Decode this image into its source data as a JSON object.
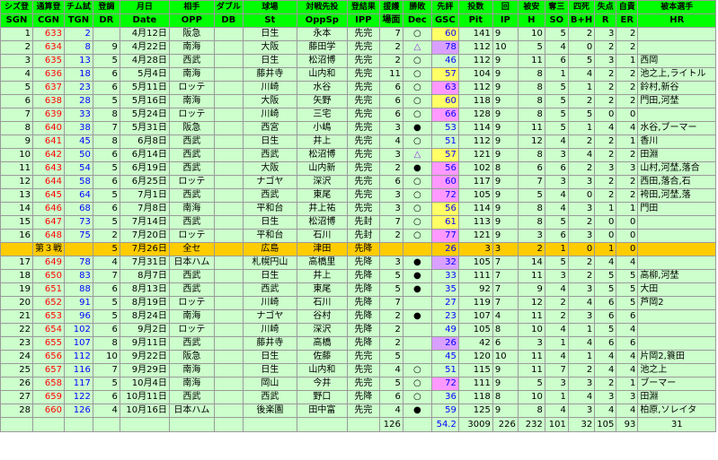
{
  "headers_top": [
    "シズ登",
    "通算登",
    "チム試",
    "登調",
    "月日",
    "相手",
    "ダブル",
    "球場",
    "対戦先投",
    "登結果",
    "援護",
    "勝敗",
    "先評",
    "投数",
    "回",
    "被安",
    "奪三",
    "四死",
    "失点",
    "自責",
    "被本選手"
  ],
  "headers_bottom": [
    "SGN",
    "CGN",
    "TGN",
    "DR",
    "Date",
    "OPP",
    "DB",
    "St",
    "OppSp",
    "IPP",
    "場面",
    "Dec",
    "GSC",
    "Pit",
    "IP",
    "H",
    "SO",
    "B+H",
    "R",
    "ER",
    "HR"
  ],
  "rows": [
    {
      "sgn": "1",
      "cgn": "633",
      "tgn": "2",
      "dr": "",
      "date": "4月12日",
      "opp": "阪急",
      "db": "",
      "st": "日生",
      "oppsp": "永本",
      "ipp": "先完",
      "sc": "7",
      "dec": "○",
      "gsc": "60",
      "gsc_class": "gsc-hi",
      "pit": "141",
      "ip": "9",
      "h": "10",
      "so": "5",
      "bh": "2",
      "r": "3",
      "er": "2",
      "hr": ""
    },
    {
      "sgn": "2",
      "cgn": "634",
      "tgn": "8",
      "dr": "9",
      "date": "4月22日",
      "opp": "南海",
      "db": "",
      "st": "大阪",
      "oppsp": "藤田学",
      "ipp": "先完",
      "sc": "2",
      "dec": "△",
      "gsc": "78",
      "gsc_class": "gsc-low",
      "pit": "112",
      "ip": "10",
      "h": "5",
      "so": "4",
      "bh": "0",
      "r": "2",
      "er": "2",
      "hr": ""
    },
    {
      "sgn": "3",
      "cgn": "635",
      "tgn": "13",
      "dr": "5",
      "date": "4月28日",
      "opp": "西武",
      "db": "",
      "st": "日生",
      "oppsp": "松沼博",
      "ipp": "先完",
      "sc": "2",
      "dec": "○",
      "gsc": "46",
      "gsc_class": "",
      "pit": "112",
      "ip": "9",
      "h": "11",
      "so": "6",
      "bh": "5",
      "r": "3",
      "er": "1",
      "hr": "西岡"
    },
    {
      "sgn": "4",
      "cgn": "636",
      "tgn": "18",
      "dr": "6",
      "date": "5月4日",
      "opp": "南海",
      "db": "",
      "st": "藤井寺",
      "oppsp": "山内和",
      "ipp": "先完",
      "sc": "11",
      "dec": "○",
      "gsc": "57",
      "gsc_class": "gsc-hi",
      "pit": "104",
      "ip": "9",
      "h": "8",
      "so": "1",
      "bh": "4",
      "r": "2",
      "er": "2",
      "hr": "池之上,ライトル"
    },
    {
      "sgn": "5",
      "cgn": "637",
      "tgn": "23",
      "dr": "6",
      "date": "5月11日",
      "opp": "ロッテ",
      "db": "",
      "st": "川崎",
      "oppsp": "水谷",
      "ipp": "先完",
      "sc": "6",
      "dec": "○",
      "gsc": "63",
      "gsc_class": "gsc-mid",
      "pit": "112",
      "ip": "9",
      "h": "8",
      "so": "5",
      "bh": "1",
      "r": "2",
      "er": "2",
      "hr": "鈴村,新谷"
    },
    {
      "sgn": "6",
      "cgn": "638",
      "tgn": "28",
      "dr": "5",
      "date": "5月16日",
      "opp": "南海",
      "db": "",
      "st": "大阪",
      "oppsp": "矢野",
      "ipp": "先完",
      "sc": "6",
      "dec": "○",
      "gsc": "60",
      "gsc_class": "gsc-hi",
      "pit": "118",
      "ip": "9",
      "h": "8",
      "so": "5",
      "bh": "2",
      "r": "2",
      "er": "2",
      "hr": "門田,河埜"
    },
    {
      "sgn": "7",
      "cgn": "639",
      "tgn": "33",
      "dr": "8",
      "date": "5月24日",
      "opp": "ロッテ",
      "db": "",
      "st": "川崎",
      "oppsp": "三宅",
      "ipp": "先完",
      "sc": "6",
      "dec": "○",
      "gsc": "66",
      "gsc_class": "gsc-mid",
      "pit": "128",
      "ip": "9",
      "h": "8",
      "so": "5",
      "bh": "5",
      "r": "0",
      "er": "0",
      "hr": ""
    },
    {
      "sgn": "8",
      "cgn": "640",
      "tgn": "38",
      "dr": "7",
      "date": "5月31日",
      "opp": "阪急",
      "db": "",
      "st": "西宮",
      "oppsp": "小嶋",
      "ipp": "先完",
      "sc": "3",
      "dec": "●",
      "gsc": "53",
      "gsc_class": "",
      "pit": "114",
      "ip": "9",
      "h": "11",
      "so": "5",
      "bh": "1",
      "r": "4",
      "er": "4",
      "hr": "水谷,ブーマー"
    },
    {
      "sgn": "9",
      "cgn": "641",
      "tgn": "45",
      "dr": "8",
      "date": "6月8日",
      "opp": "西武",
      "db": "",
      "st": "日生",
      "oppsp": "井上",
      "ipp": "先完",
      "sc": "4",
      "dec": "○",
      "gsc": "51",
      "gsc_class": "",
      "pit": "112",
      "ip": "9",
      "h": "12",
      "so": "4",
      "bh": "2",
      "r": "2",
      "er": "1",
      "hr": "香川"
    },
    {
      "sgn": "10",
      "cgn": "642",
      "tgn": "50",
      "dr": "6",
      "date": "6月14日",
      "opp": "西武",
      "db": "",
      "st": "西武",
      "oppsp": "松沼博",
      "ipp": "先完",
      "sc": "3",
      "dec": "△",
      "gsc": "57",
      "gsc_class": "gsc-hi",
      "pit": "121",
      "ip": "9",
      "h": "8",
      "so": "3",
      "bh": "4",
      "r": "2",
      "er": "2",
      "hr": "田淵"
    },
    {
      "sgn": "11",
      "cgn": "643",
      "tgn": "54",
      "dr": "5",
      "date": "6月19日",
      "opp": "西武",
      "db": "",
      "st": "大阪",
      "oppsp": "山内新",
      "ipp": "先完",
      "sc": "2",
      "dec": "●",
      "gsc": "56",
      "gsc_class": "gsc-mid",
      "pit": "102",
      "ip": "8",
      "h": "6",
      "so": "6",
      "bh": "2",
      "r": "3",
      "er": "3",
      "hr": "山村,河埜,落合"
    },
    {
      "sgn": "12",
      "cgn": "644",
      "tgn": "58",
      "dr": "6",
      "date": "6月25日",
      "opp": "ロッテ",
      "db": "",
      "st": "ナゴヤ",
      "oppsp": "深沢",
      "ipp": "先完",
      "sc": "6",
      "dec": "○",
      "gsc": "60",
      "gsc_class": "gsc-mid",
      "pit": "117",
      "ip": "9",
      "h": "7",
      "so": "3",
      "bh": "3",
      "r": "2",
      "er": "2",
      "hr": "西田,落合,石"
    },
    {
      "sgn": "13",
      "cgn": "645",
      "tgn": "64",
      "dr": "5",
      "date": "7月1日",
      "opp": "西武",
      "db": "",
      "st": "西武",
      "oppsp": "東尾",
      "ipp": "先完",
      "sc": "3",
      "dec": "○",
      "gsc": "72",
      "gsc_class": "gsc-mid",
      "pit": "105",
      "ip": "9",
      "h": "5",
      "so": "4",
      "bh": "0",
      "r": "2",
      "er": "2",
      "hr": "袴田,河埜,落"
    },
    {
      "sgn": "14",
      "cgn": "646",
      "tgn": "68",
      "dr": "6",
      "date": "7月8日",
      "opp": "南海",
      "db": "",
      "st": "平和台",
      "oppsp": "井上祐",
      "ipp": "先完",
      "sc": "3",
      "dec": "○",
      "gsc": "56",
      "gsc_class": "gsc-hi",
      "pit": "114",
      "ip": "9",
      "h": "8",
      "so": "4",
      "bh": "3",
      "r": "1",
      "er": "1",
      "hr": "門田"
    },
    {
      "sgn": "15",
      "cgn": "647",
      "tgn": "73",
      "dr": "5",
      "date": "7月14日",
      "opp": "西武",
      "db": "",
      "st": "日生",
      "oppsp": "松沼博",
      "ipp": "先封",
      "sc": "7",
      "dec": "○",
      "gsc": "61",
      "gsc_class": "gsc-hi",
      "pit": "113",
      "ip": "9",
      "h": "8",
      "so": "5",
      "bh": "2",
      "r": "0",
      "er": "0",
      "hr": ""
    },
    {
      "sgn": "16",
      "cgn": "648",
      "tgn": "75",
      "dr": "2",
      "date": "7月20日",
      "opp": "ロッテ",
      "db": "",
      "st": "平和台",
      "oppsp": "石川",
      "ipp": "先封",
      "sc": "2",
      "dec": "○",
      "gsc": "77",
      "gsc_class": "gsc-mid",
      "pit": "121",
      "ip": "9",
      "h": "3",
      "so": "6",
      "bh": "3",
      "r": "0",
      "er": "0",
      "hr": ""
    },
    {
      "special": true,
      "sgn": "",
      "cgn": "第３戦",
      "tgn": "",
      "dr": "5",
      "date": "7月26日",
      "opp": "全セ",
      "db": "",
      "st": "広島",
      "oppsp": "津田",
      "ipp": "先降",
      "sc": "",
      "dec": "",
      "gsc": "26",
      "gsc_class": "",
      "pit": "3",
      "ip": "3",
      "h": "2",
      "so": "1",
      "bh": "0",
      "r": "1",
      "er": "0",
      "hr": ""
    },
    {
      "sgn": "17",
      "cgn": "649",
      "tgn": "78",
      "dr": "4",
      "date": "7月31日",
      "opp": "日本ハム",
      "db": "",
      "st": "札幌円山",
      "oppsp": "高橋里",
      "ipp": "先降",
      "sc": "3",
      "dec": "●",
      "gsc": "32",
      "gsc_class": "gsc-low",
      "pit": "105",
      "ip": "7",
      "h": "14",
      "so": "5",
      "bh": "2",
      "r": "4",
      "er": "4",
      "hr": ""
    },
    {
      "sgn": "18",
      "cgn": "650",
      "tgn": "83",
      "dr": "7",
      "date": "8月7日",
      "opp": "西武",
      "db": "",
      "st": "日生",
      "oppsp": "井上",
      "ipp": "先降",
      "sc": "5",
      "dec": "●",
      "gsc": "33",
      "gsc_class": "",
      "pit": "111",
      "ip": "7",
      "h": "11",
      "so": "3",
      "bh": "2",
      "r": "5",
      "er": "5",
      "hr": "高柳,河埜"
    },
    {
      "sgn": "19",
      "cgn": "651",
      "tgn": "88",
      "dr": "6",
      "date": "8月13日",
      "opp": "西武",
      "db": "",
      "st": "西武",
      "oppsp": "東尾",
      "ipp": "先降",
      "sc": "5",
      "dec": "●",
      "gsc": "35",
      "gsc_class": "",
      "pit": "92",
      "ip": "7",
      "h": "9",
      "so": "4",
      "bh": "3",
      "r": "5",
      "er": "5",
      "hr": "大田"
    },
    {
      "sgn": "20",
      "cgn": "652",
      "tgn": "91",
      "dr": "5",
      "date": "8月19日",
      "opp": "ロッテ",
      "db": "",
      "st": "川崎",
      "oppsp": "石川",
      "ipp": "先降",
      "sc": "7",
      "dec": "",
      "gsc": "27",
      "gsc_class": "",
      "pit": "119",
      "ip": "7",
      "h": "12",
      "so": "2",
      "bh": "4",
      "r": "6",
      "er": "5",
      "hr": "芦岡2"
    },
    {
      "sgn": "21",
      "cgn": "653",
      "tgn": "96",
      "dr": "5",
      "date": "8月24日",
      "opp": "南海",
      "db": "",
      "st": "ナゴヤ",
      "oppsp": "谷村",
      "ipp": "先降",
      "sc": "2",
      "dec": "●",
      "gsc": "23",
      "gsc_class": "",
      "pit": "107",
      "ip": "4",
      "h": "11",
      "so": "2",
      "bh": "3",
      "r": "6",
      "er": "6",
      "hr": ""
    },
    {
      "sgn": "22",
      "cgn": "654",
      "tgn": "102",
      "dr": "6",
      "date": "9月2日",
      "opp": "ロッテ",
      "db": "",
      "st": "川崎",
      "oppsp": "深沢",
      "ipp": "先降",
      "sc": "2",
      "dec": "",
      "gsc": "49",
      "gsc_class": "",
      "pit": "105",
      "ip": "8",
      "h": "10",
      "so": "4",
      "bh": "1",
      "r": "5",
      "er": "4",
      "hr": ""
    },
    {
      "sgn": "23",
      "cgn": "655",
      "tgn": "107",
      "dr": "8",
      "date": "9月11日",
      "opp": "西武",
      "db": "",
      "st": "藤井寺",
      "oppsp": "高橋",
      "ipp": "先降",
      "sc": "2",
      "dec": "",
      "gsc": "26",
      "gsc_class": "gsc-low",
      "pit": "42",
      "ip": "6",
      "h": "3",
      "so": "1",
      "bh": "4",
      "r": "6",
      "er": "6",
      "hr": ""
    },
    {
      "sgn": "24",
      "cgn": "656",
      "tgn": "112",
      "dr": "10",
      "date": "9月22日",
      "opp": "阪急",
      "db": "",
      "st": "日生",
      "oppsp": "佐藤",
      "ipp": "先完",
      "sc": "5",
      "dec": "",
      "gsc": "45",
      "gsc_class": "",
      "pit": "120",
      "ip": "10",
      "h": "11",
      "so": "4",
      "bh": "1",
      "r": "4",
      "er": "4",
      "hr": "片岡2,簑田"
    },
    {
      "sgn": "25",
      "cgn": "657",
      "tgn": "116",
      "dr": "7",
      "date": "9月29日",
      "opp": "南海",
      "db": "",
      "st": "日生",
      "oppsp": "山内和",
      "ipp": "先完",
      "sc": "4",
      "dec": "○",
      "gsc": "51",
      "gsc_class": "",
      "pit": "115",
      "ip": "9",
      "h": "11",
      "so": "7",
      "bh": "2",
      "r": "4",
      "er": "4",
      "hr": "池之上"
    },
    {
      "sgn": "26",
      "cgn": "658",
      "tgn": "117",
      "dr": "5",
      "date": "10月4日",
      "opp": "南海",
      "db": "",
      "st": "岡山",
      "oppsp": "今井",
      "ipp": "先完",
      "sc": "5",
      "dec": "○",
      "gsc": "72",
      "gsc_class": "gsc-mid",
      "pit": "111",
      "ip": "9",
      "h": "5",
      "so": "3",
      "bh": "3",
      "r": "2",
      "er": "1",
      "hr": "ブーマー"
    },
    {
      "sgn": "27",
      "cgn": "659",
      "tgn": "122",
      "dr": "6",
      "date": "10月11日",
      "opp": "西武",
      "db": "",
      "st": "西武",
      "oppsp": "野口",
      "ipp": "先降",
      "sc": "6",
      "dec": "○",
      "gsc": "36",
      "gsc_class": "",
      "pit": "118",
      "ip": "8",
      "h": "10",
      "so": "1",
      "bh": "4",
      "r": "3",
      "er": "3",
      "hr": "田淵"
    },
    {
      "sgn": "28",
      "cgn": "660",
      "tgn": "126",
      "dr": "4",
      "date": "10月16日",
      "opp": "日本ハム",
      "db": "",
      "st": "後楽園",
      "oppsp": "田中富",
      "ipp": "先完",
      "sc": "4",
      "dec": "●",
      "gsc": "59",
      "gsc_class": "",
      "pit": "125",
      "ip": "9",
      "h": "8",
      "so": "4",
      "bh": "3",
      "r": "4",
      "er": "4",
      "hr": "柏原,ソレイタ"
    }
  ],
  "totals": {
    "tgn": "126",
    "gsc": "54.2",
    "pit": "3009",
    "ip": "226",
    "h": "232",
    "so": "101",
    "bh": "32",
    "r": "105",
    "er": "93",
    "hr": "31"
  }
}
